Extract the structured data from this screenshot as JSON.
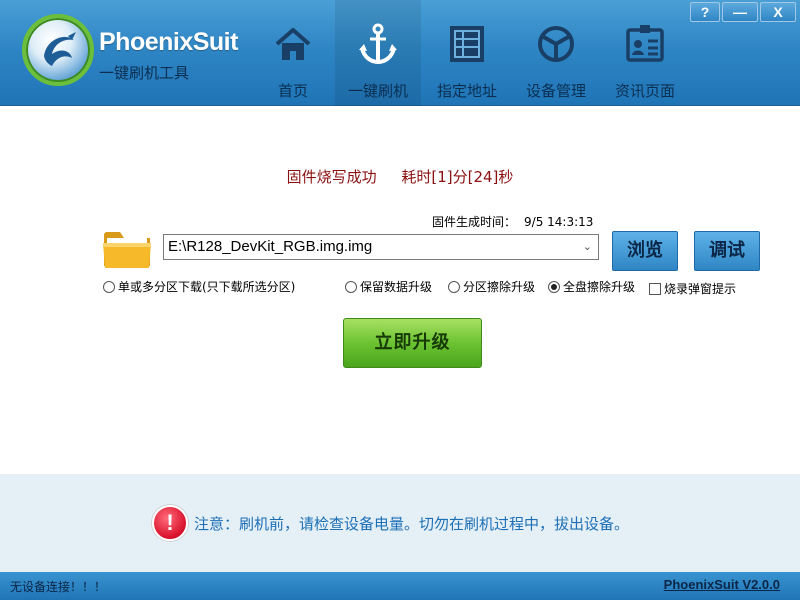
{
  "window": {
    "help_label": "?",
    "minimize_label": "—",
    "close_label": "X"
  },
  "logo": {
    "title": "PhoenixSuit",
    "subtitle": "一键刷机工具"
  },
  "nav": [
    {
      "label": "首页",
      "icon": "home-icon"
    },
    {
      "label": "一键刷机",
      "icon": "anchor-icon"
    },
    {
      "label": "指定地址",
      "icon": "grid-icon"
    },
    {
      "label": "设备管理",
      "icon": "cube-icon"
    },
    {
      "label": "资讯页面",
      "icon": "news-icon"
    }
  ],
  "flash": {
    "status": "固件烧写成功",
    "elapsed": "耗时[1]分[24]秒",
    "gen_time_label": "固件生成时间：",
    "gen_time_value": "9/5 14:3:13",
    "image_path": "E:\\R128_DevKit_RGB.img.img",
    "browse_label": "浏览",
    "debug_label": "调试",
    "upgrade_label": "立即升级"
  },
  "options": {
    "single_multi": "单或多分区下载(只下载所选分区)",
    "keep_data": "保留数据升级",
    "partition_erase": "分区擦除升级",
    "full_erase": "全盘擦除升级",
    "popup_hint": "烧录弹窗提示",
    "selected": "full_erase"
  },
  "notice": {
    "text": "注意：刷机前，请检查设备电量。切勿在刷机过程中，拔出设备。"
  },
  "statusbar": {
    "device_status": "无设备连接！！！",
    "version": "PhoenixSuit V2.0.0"
  },
  "colors": {
    "header_blue": "#2f86c4",
    "success_text": "#8b1010",
    "notice_text": "#1d6fb5",
    "upgrade_green": "#6cc332"
  }
}
